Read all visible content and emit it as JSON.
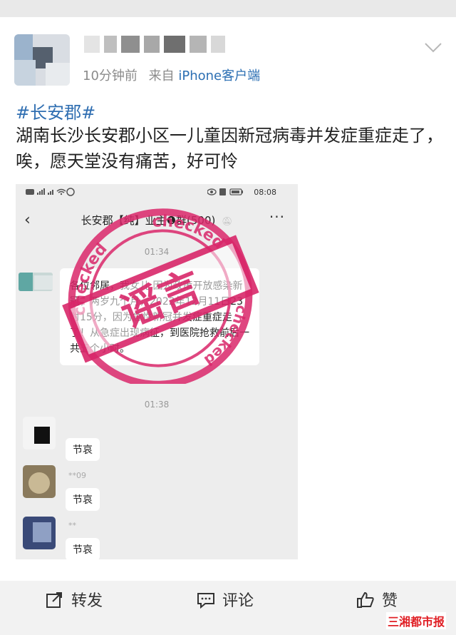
{
  "post": {
    "time": "10分钟前",
    "source_prefix": "来自",
    "source": "iPhone客户端",
    "hashtag": "#长安郡#",
    "text": "湖南长沙长安郡小区一儿童因新冠病毒并发症重症走了，唉，愿天堂没有痛苦，好可怜"
  },
  "screenshot": {
    "status_time": "08:08",
    "chat_title": "长安郡【纯】业主❶群(500)",
    "time1": "01:34",
    "message": "各位邻居，我女儿 因为政策开放感染新冠，两岁九个月，2022年12月11日23时15分，因为急性新冠并发症重症走了！从急症出现病征，到医院抢救前后一共五个小时。",
    "time2": "01:38",
    "reply": "节哀",
    "sender2": "**09",
    "sender3": "**"
  },
  "stamp": {
    "word": "谣言",
    "ring_text": "checked",
    "color": "#d9276a"
  },
  "actions": {
    "repost": "转发",
    "comment": "评论",
    "like": "赞"
  },
  "watermark": "三湘都市报"
}
